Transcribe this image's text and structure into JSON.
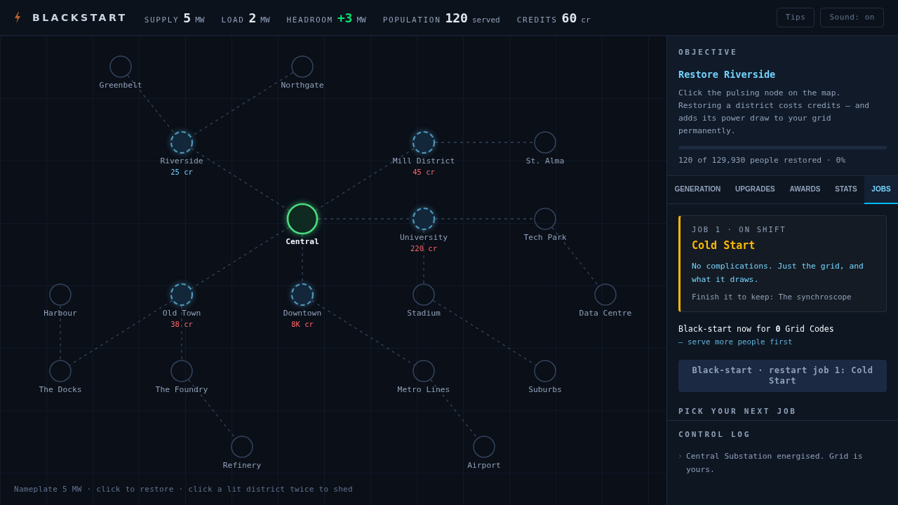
{
  "header": {
    "title": "BLACKSTART",
    "stats": [
      {
        "label": "SUPPLY",
        "value": "5",
        "unit": "MW",
        "kind": "plain"
      },
      {
        "label": "LOAD",
        "value": "2",
        "unit": "MW",
        "kind": "plain"
      },
      {
        "label": "HEADROOM",
        "value": "+3",
        "unit": "MW",
        "kind": "positive"
      },
      {
        "label": "POPULATION",
        "value": "120",
        "unit": "served",
        "kind": "plain"
      },
      {
        "label": "CREDITS",
        "value": "60",
        "unit": "cr",
        "kind": "plain"
      }
    ],
    "buttons": [
      "Tips",
      "Sound: on"
    ]
  },
  "map": {
    "nodes": [
      {
        "name": "Greenbelt",
        "kind": "dark"
      },
      {
        "name": "Northgate",
        "kind": "dark"
      },
      {
        "name": "Riverside",
        "kind": "available",
        "cost": "25 cr",
        "affordable": true
      },
      {
        "name": "Mill District",
        "kind": "available",
        "cost": "45 cr",
        "affordable": false
      },
      {
        "name": "St. Alma",
        "kind": "dark"
      },
      {
        "name": "Central",
        "kind": "lit"
      },
      {
        "name": "University",
        "kind": "available",
        "cost": "220 cr",
        "affordable": false
      },
      {
        "name": "Tech Park",
        "kind": "dark"
      },
      {
        "name": "Harbour",
        "kind": "dark"
      },
      {
        "name": "Old Town",
        "kind": "available",
        "cost": "38 cr",
        "affordable": false
      },
      {
        "name": "Downtown",
        "kind": "available",
        "cost": "8K cr",
        "affordable": false
      },
      {
        "name": "Stadium",
        "kind": "dark"
      },
      {
        "name": "Data Centre",
        "kind": "dark"
      },
      {
        "name": "The Docks",
        "kind": "dark"
      },
      {
        "name": "The Foundry",
        "kind": "dark"
      },
      {
        "name": "Metro Lines",
        "kind": "dark"
      },
      {
        "name": "Suburbs",
        "kind": "dark"
      },
      {
        "name": "Refinery",
        "kind": "dark"
      },
      {
        "name": "Airport",
        "kind": "dark"
      }
    ],
    "hint": "Nameplate 5 MW · click to restore · click a lit district twice to shed"
  },
  "objective": {
    "heading": "OBJECTIVE",
    "title": "Restore Riverside",
    "text": "Click the pulsing node on the map. Restoring a district costs credits — and adds its power draw to your grid permanently.",
    "level": 0,
    "progress": "120 of 129,930 people restored · 0%"
  },
  "tabs": [
    {
      "label": "GENERATION",
      "selected": false
    },
    {
      "label": "UPGRADES",
      "selected": false
    },
    {
      "label": "AWARDS",
      "selected": false
    },
    {
      "label": "STATS",
      "selected": false
    },
    {
      "label": "JOBS",
      "selected": true
    }
  ],
  "job": {
    "meta": "JOB 1 · ON SHIFT",
    "title": "Cold Start",
    "description": "No complications. Just the grid, and what it draws.",
    "reward": "Finish it to keep: The synchroscope"
  },
  "blackstart": {
    "text": "Black-start now for **0** Grid Codes",
    "note": "— serve more people first",
    "button": "Black-start · restart job 1: Cold Start",
    "disabled": true
  },
  "next_job": {
    "heading": "PICK YOUR NEXT JOB"
  },
  "control_log": {
    "heading": "CONTROL LOG",
    "entries": [
      "Central Substation energised. Grid is yours."
    ]
  }
}
